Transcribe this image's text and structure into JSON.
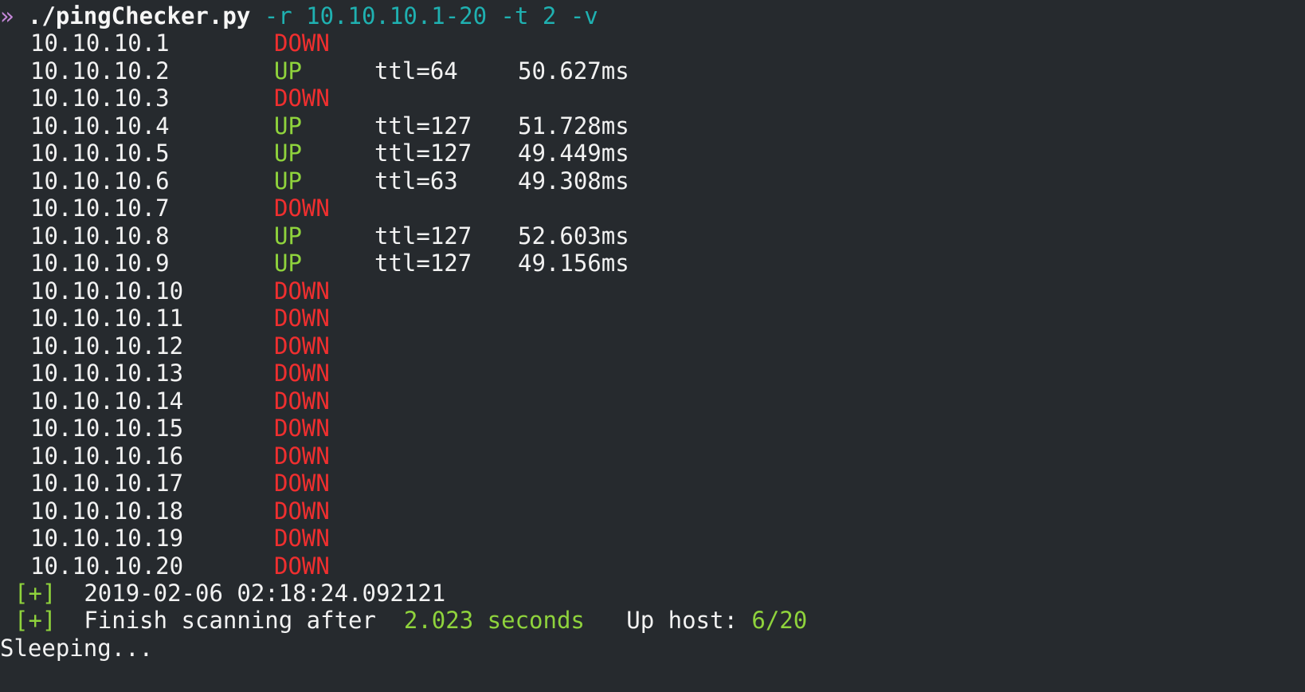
{
  "command": {
    "prompt": "» ",
    "name": "./pingChecker.py",
    "args": " -r 10.10.10.1-20 -t 2 -v"
  },
  "rows": [
    {
      "ip": "10.10.10.1",
      "status": "DOWN",
      "ttl": "",
      "time": ""
    },
    {
      "ip": "10.10.10.2",
      "status": "UP",
      "ttl": "ttl=64",
      "time": "50.627ms"
    },
    {
      "ip": "10.10.10.3",
      "status": "DOWN",
      "ttl": "",
      "time": ""
    },
    {
      "ip": "10.10.10.4",
      "status": "UP",
      "ttl": "ttl=127",
      "time": "51.728ms"
    },
    {
      "ip": "10.10.10.5",
      "status": "UP",
      "ttl": "ttl=127",
      "time": "49.449ms"
    },
    {
      "ip": "10.10.10.6",
      "status": "UP",
      "ttl": "ttl=63",
      "time": "49.308ms"
    },
    {
      "ip": "10.10.10.7",
      "status": "DOWN",
      "ttl": "",
      "time": ""
    },
    {
      "ip": "10.10.10.8",
      "status": "UP",
      "ttl": "ttl=127",
      "time": "52.603ms"
    },
    {
      "ip": "10.10.10.9",
      "status": "UP",
      "ttl": "ttl=127",
      "time": "49.156ms"
    },
    {
      "ip": "10.10.10.10",
      "status": "DOWN",
      "ttl": "",
      "time": ""
    },
    {
      "ip": "10.10.10.11",
      "status": "DOWN",
      "ttl": "",
      "time": ""
    },
    {
      "ip": "10.10.10.12",
      "status": "DOWN",
      "ttl": "",
      "time": ""
    },
    {
      "ip": "10.10.10.13",
      "status": "DOWN",
      "ttl": "",
      "time": ""
    },
    {
      "ip": "10.10.10.14",
      "status": "DOWN",
      "ttl": "",
      "time": ""
    },
    {
      "ip": "10.10.10.15",
      "status": "DOWN",
      "ttl": "",
      "time": ""
    },
    {
      "ip": "10.10.10.16",
      "status": "DOWN",
      "ttl": "",
      "time": ""
    },
    {
      "ip": "10.10.10.17",
      "status": "DOWN",
      "ttl": "",
      "time": ""
    },
    {
      "ip": "10.10.10.18",
      "status": "DOWN",
      "ttl": "",
      "time": ""
    },
    {
      "ip": "10.10.10.19",
      "status": "DOWN",
      "ttl": "",
      "time": ""
    },
    {
      "ip": "10.10.10.20",
      "status": "DOWN",
      "ttl": "",
      "time": ""
    }
  ],
  "summary": {
    "bracket": "[+]",
    "timestamp": "2019-02-06 02:18:24.092121",
    "finish_prefix": "Finish scanning after  ",
    "duration": "2.023 seconds",
    "up_label": "   Up host: ",
    "up_count": "6/20"
  },
  "sleeping": "Sleeping...",
  "colors": {
    "background": "#262a2e",
    "up": "#8fd33c",
    "down": "#ef2f2f",
    "args": "#1fb1b1",
    "prompt": "#c487d8"
  }
}
